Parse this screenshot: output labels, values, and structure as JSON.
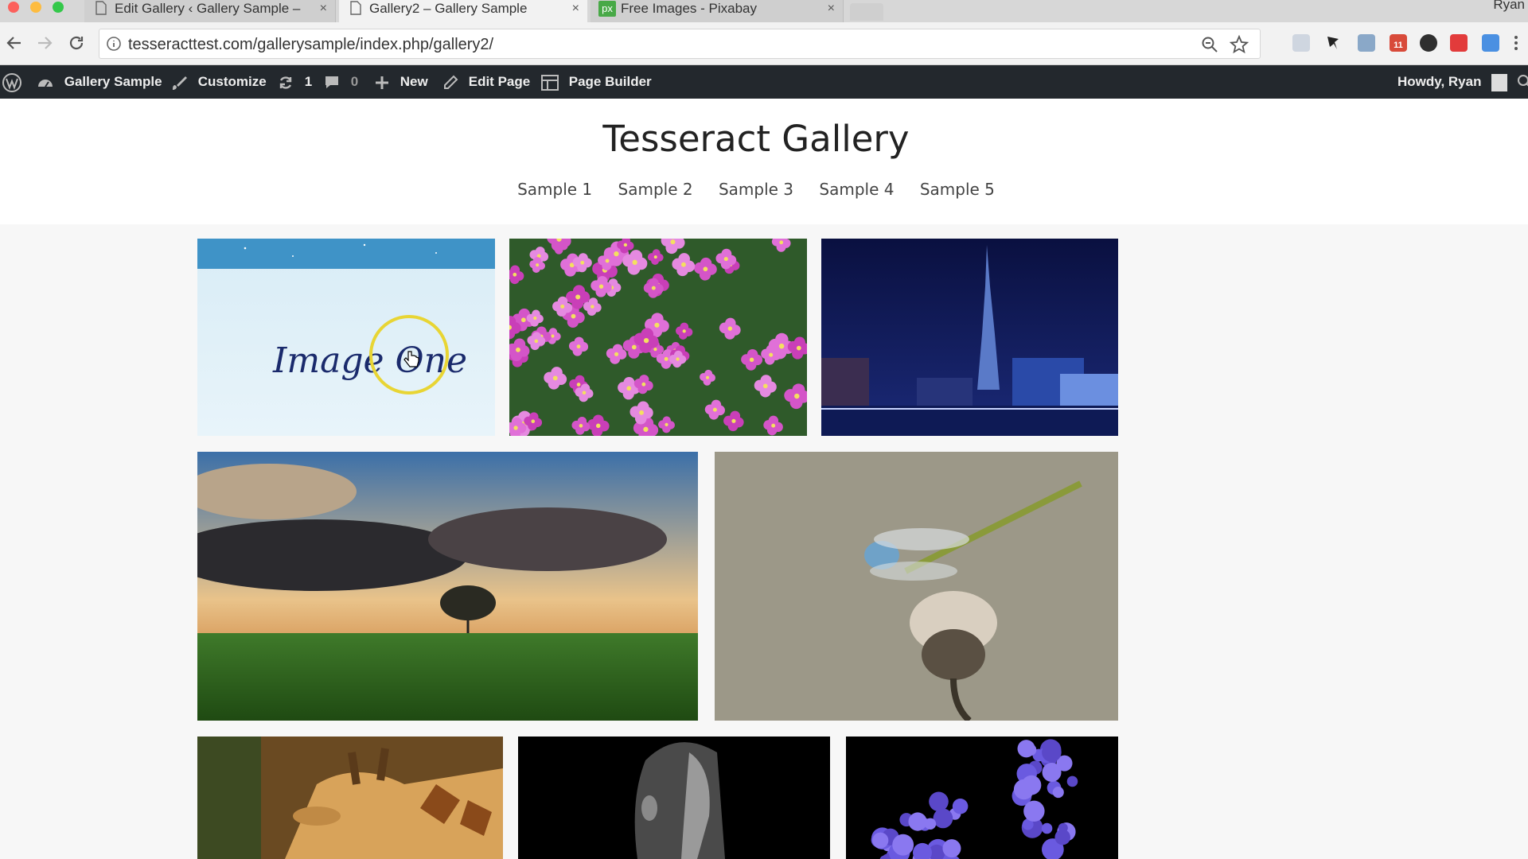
{
  "browser": {
    "tabs": [
      {
        "title": "Edit Gallery ‹ Gallery Sample –",
        "close": "×"
      },
      {
        "title": "Gallery2 – Gallery Sample",
        "close": "×"
      },
      {
        "title": "Free Images - Pixabay",
        "close": "×",
        "favicon_text": "px"
      }
    ],
    "profile": "Ryan",
    "url": "tesseracttest.com/gallerysample/index.php/gallery2/",
    "ext_badge": "11"
  },
  "adminbar": {
    "site": "Gallery Sample",
    "customize": "Customize",
    "updates": "1",
    "comments": "0",
    "new": "New",
    "edit_page": "Edit Page",
    "page_builder": "Page Builder",
    "howdy": "Howdy, Ryan"
  },
  "site": {
    "title": "Tesseract Gallery",
    "menu": [
      "Sample 1",
      "Sample 2",
      "Sample 3",
      "Sample 4",
      "Sample 5"
    ]
  },
  "gallery": {
    "image_one_text": "Image One"
  }
}
